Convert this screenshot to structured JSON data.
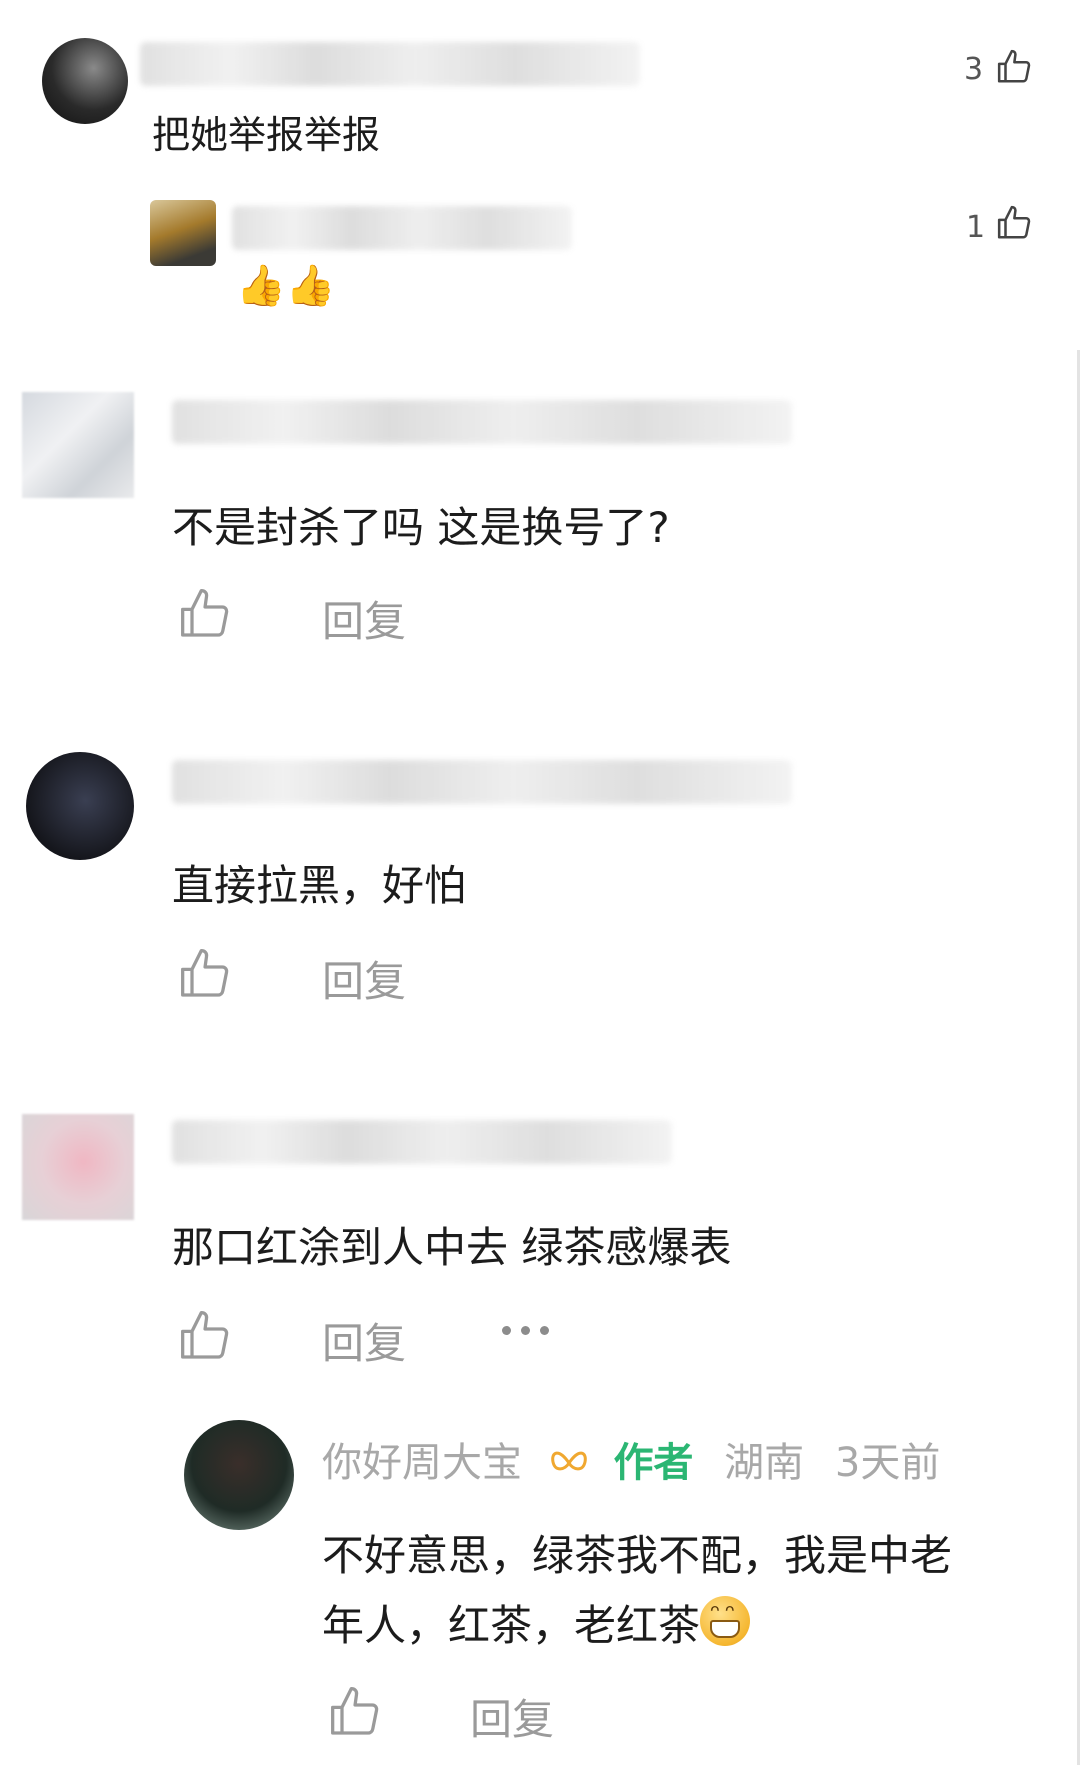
{
  "comments": [
    {
      "text": "把她举报举报",
      "likes": "3",
      "reply": {
        "likes": "1",
        "text_emoji": "👍👍"
      }
    },
    {
      "text": "不是封杀了吗 这是换号了?",
      "reply_label": "回复"
    },
    {
      "text": "直接拉黑，好怕",
      "reply_label": "回复"
    },
    {
      "text": "那口红涂到人中去 绿茶感爆表",
      "reply_label": "回复",
      "more_icon": "more-dots-icon",
      "author_reply": {
        "username": "你好周大宝",
        "badge": "作者",
        "location": "湖南",
        "time": "3天前",
        "text_line1": "不好意思，绿茶我不配，我是中老",
        "text_line2": "年人，红茶，老红茶",
        "reply_label": "回复"
      }
    }
  ],
  "colors": {
    "author_badge": "#2bb673",
    "meta_gray": "#a8a8a8",
    "icon_gray": "#9a9a9a"
  }
}
